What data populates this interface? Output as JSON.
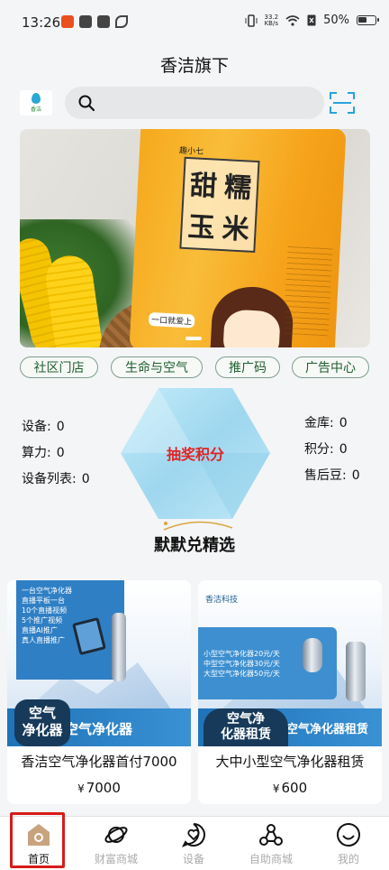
{
  "status_bar": {
    "time": "13:26",
    "network_speed_value": "33.2",
    "network_speed_unit": "KB/s",
    "battery": "50%"
  },
  "header": {
    "title": "香洁旗下"
  },
  "logo": {
    "text": "香洁"
  },
  "search": {
    "placeholder": ""
  },
  "banner": {
    "brand_tag": "趣小七",
    "bag_chars": [
      "甜",
      "糯",
      "玉",
      "米"
    ],
    "slogan": "一口就爱上"
  },
  "chips": [
    "社区门店",
    "生命与空气",
    "推广码",
    "广告中心"
  ],
  "stats_left": [
    {
      "label": "设备:",
      "value": "0"
    },
    {
      "label": "算力:",
      "value": "0"
    },
    {
      "label": "设备列表:",
      "value": "0"
    }
  ],
  "stats_right": [
    {
      "label": "金库:",
      "value": "0"
    },
    {
      "label": "积分:",
      "value": "0"
    },
    {
      "label": "售后豆:",
      "value": "0"
    }
  ],
  "lottery": {
    "label": "抽奖积分"
  },
  "section_title": "默默兑精选",
  "products": [
    {
      "name": "香洁空气净化器首付7000",
      "currency": "¥",
      "price": "7000",
      "image_lines": [
        "一台空气净化器",
        "直播平板一台",
        "10个直播视频",
        "5个推广视频",
        "直播AI推广",
        "真人直播推广"
      ],
      "badge": "空气\n净化器",
      "band_text": "空气净化器"
    },
    {
      "name": "大中小型空气净化器租赁",
      "currency": "¥",
      "price": "600",
      "image_brand": "香洁科技",
      "image_lines": [
        "小型空气净化器20元/天",
        "中型空气净化器30元/天",
        "大型空气净化器50元/天"
      ],
      "badge": "空气净\n化器租赁",
      "band_text": "空气净化器租赁"
    }
  ],
  "tabs": [
    {
      "label": "首页",
      "active": true
    },
    {
      "label": "财富商城",
      "active": false
    },
    {
      "label": "设备",
      "active": false
    },
    {
      "label": "自助商城",
      "active": false
    },
    {
      "label": "我的",
      "active": false
    }
  ],
  "colors": {
    "accent_green": "#1f5f2f",
    "lottery_red": "#e02424",
    "highlight_red": "#d81b1b",
    "hex_blue": "#a8dcf0"
  }
}
